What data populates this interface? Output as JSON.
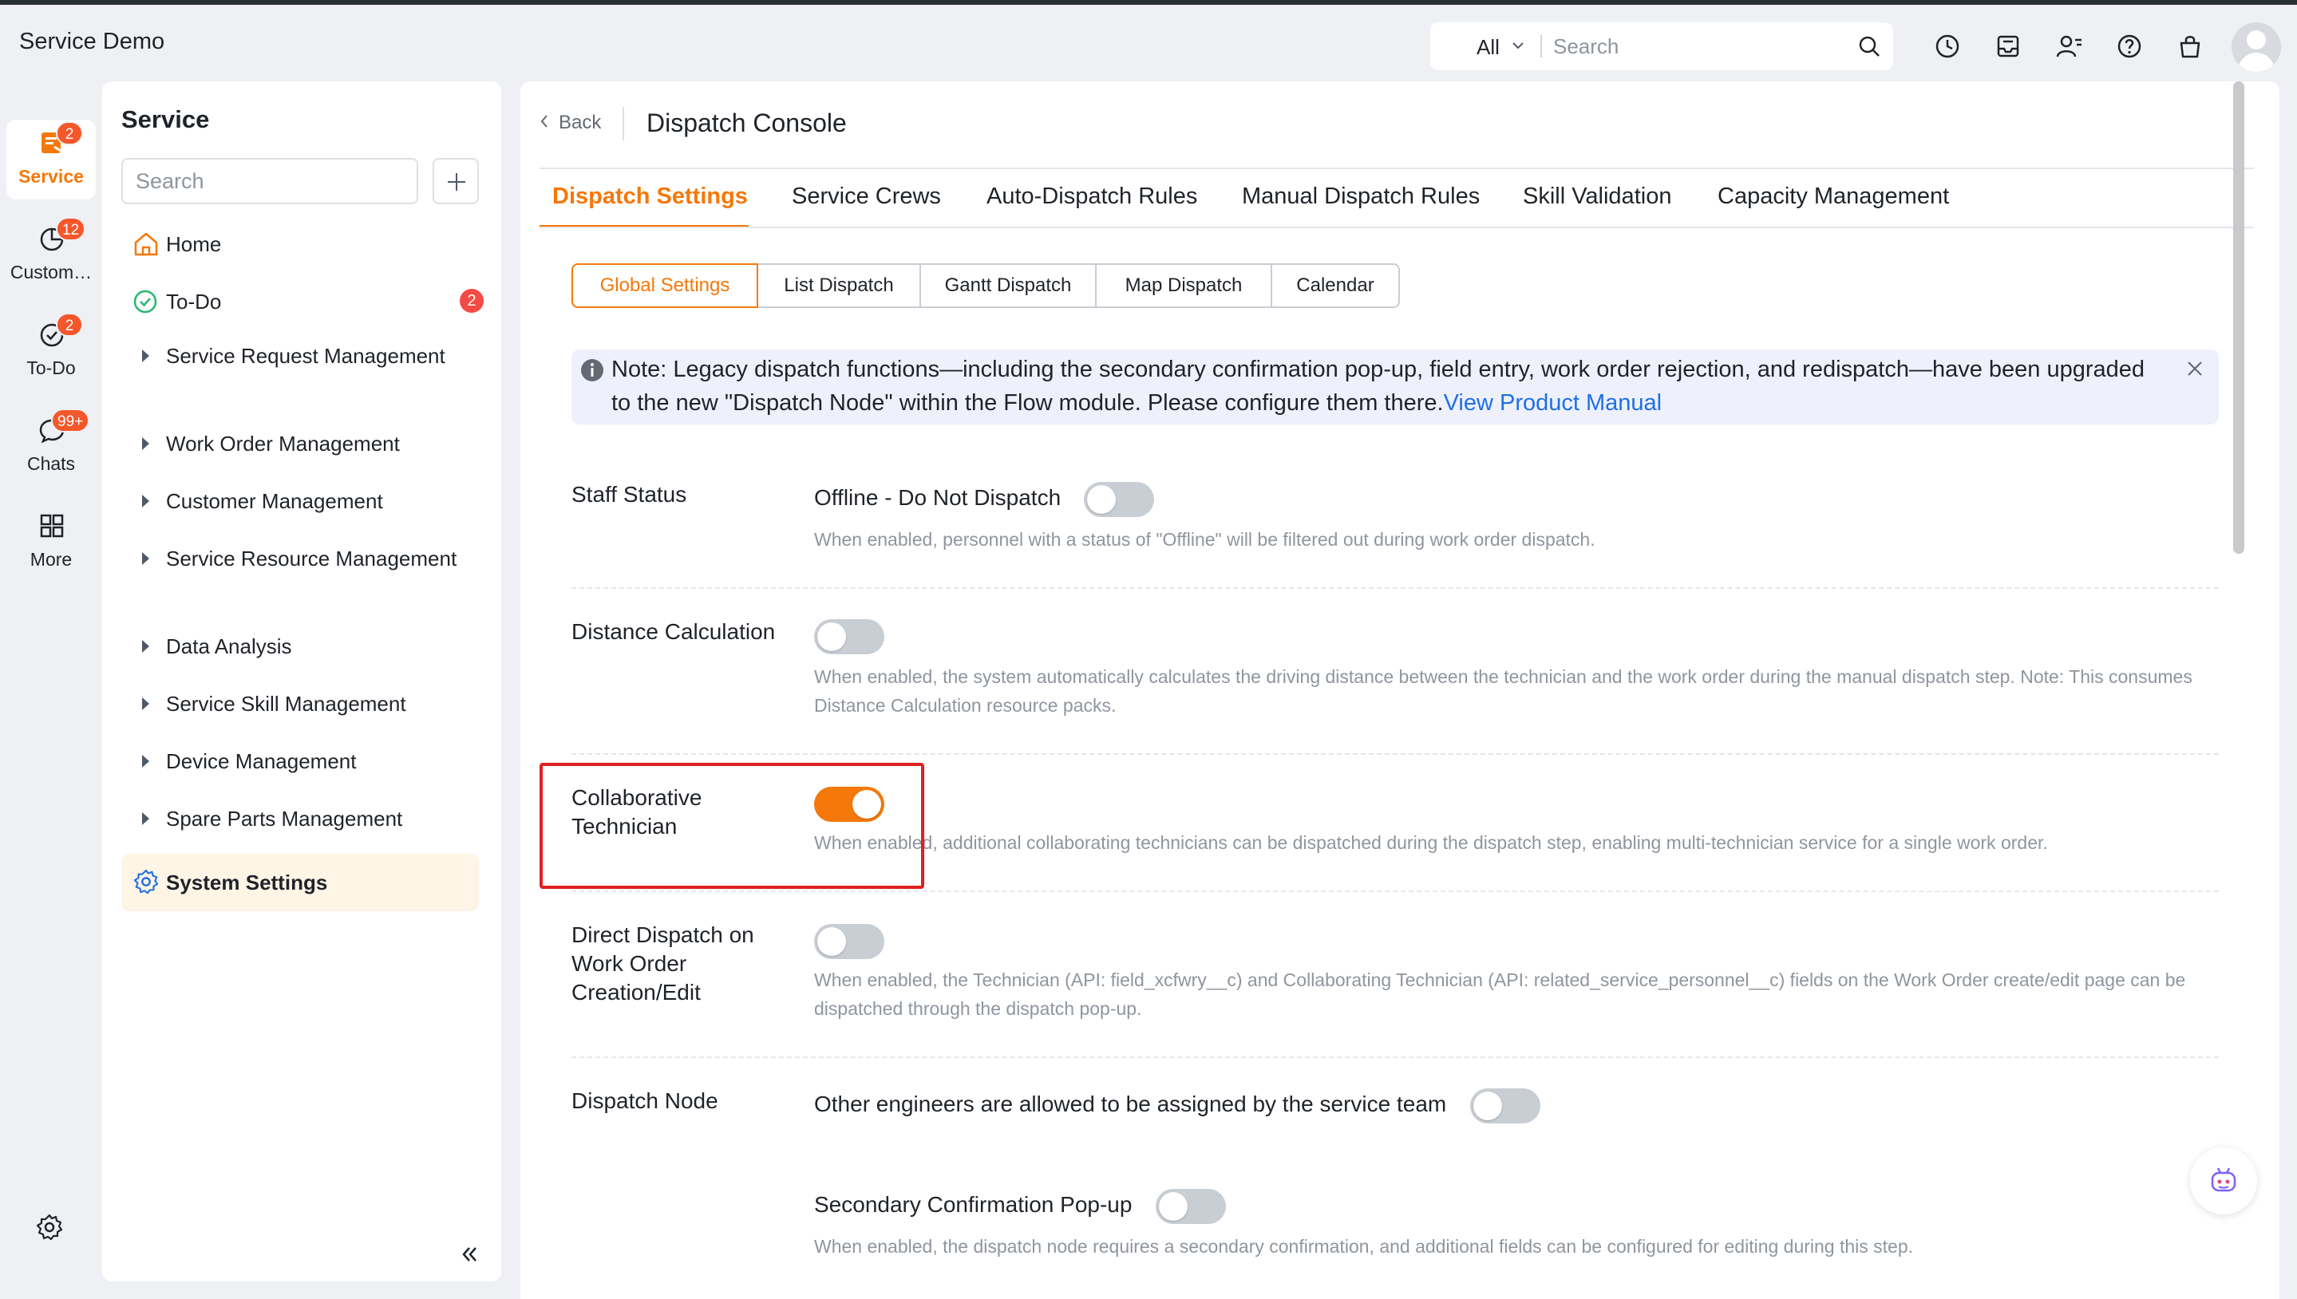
{
  "app": {
    "title": "Service Demo"
  },
  "header": {
    "search_scope": "All",
    "search_placeholder": "Search",
    "icons": [
      "clock-icon",
      "inbox-icon",
      "contacts-icon",
      "help-icon",
      "bag-icon",
      "avatar"
    ]
  },
  "rail": {
    "items": [
      {
        "label": "Service",
        "badge": "2",
        "icon": "service-icon",
        "active": true
      },
      {
        "label": "Custom…",
        "badge": "12",
        "icon": "pie-chart-icon"
      },
      {
        "label": "To-Do",
        "badge": "2",
        "icon": "check-circle-icon"
      },
      {
        "label": "Chats",
        "badge": "99+",
        "icon": "chat-bubble-icon"
      },
      {
        "label": "More",
        "icon": "grid-icon"
      }
    ]
  },
  "sidenav": {
    "title": "Service",
    "search_placeholder": "Search",
    "items": [
      {
        "label": "Home",
        "icon": "home-icon"
      },
      {
        "label": "To-Do",
        "icon": "todo-check-icon",
        "badge": "2"
      },
      {
        "label": "Service Request Management"
      },
      {
        "label": "Work Order Management"
      },
      {
        "label": "Customer Management"
      },
      {
        "label": "Service Resource Management"
      },
      {
        "label": "Data Analysis"
      },
      {
        "label": "Service Skill Management"
      },
      {
        "label": "Device Management"
      },
      {
        "label": "Spare Parts Management"
      },
      {
        "label": "System Settings",
        "icon": "settings-icon",
        "active": true
      }
    ]
  },
  "page": {
    "back": "Back",
    "title": "Dispatch Console",
    "tabs": [
      "Dispatch Settings",
      "Service Crews",
      "Auto-Dispatch Rules",
      "Manual Dispatch Rules",
      "Skill Validation",
      "Capacity Management"
    ],
    "active_tab": "Dispatch Settings",
    "segments": [
      "Global Settings",
      "List Dispatch",
      "Gantt Dispatch",
      "Map Dispatch",
      "Calendar"
    ],
    "active_segment": "Global Settings",
    "notice": {
      "text": "Note: Legacy dispatch functions—including the secondary confirmation pop-up, field entry, work order rejection, and redispatch—have been upgraded to the new \"Dispatch Node\" within the Flow module. Please configure them there.",
      "link": "View Product Manual"
    },
    "settings": [
      {
        "label": "Staff Status",
        "title": "Offline - Do Not Dispatch",
        "enabled": false,
        "desc": "When enabled, personnel with a status of \"Offline\" will be filtered out during work order dispatch."
      },
      {
        "label": "Distance Calculation",
        "enabled": false,
        "desc": "When enabled, the system automatically calculates the driving distance between the technician and the work order during the manual dispatch step. Note: This consumes Distance Calculation resource packs."
      },
      {
        "label": "Collaborative Technician",
        "enabled": true,
        "desc": "When enabled, additional collaborating technicians can be dispatched during the dispatch step, enabling multi-technician service for a single work order."
      },
      {
        "label": "Direct Dispatch on Work Order Creation/Edit",
        "enabled": false,
        "desc": "When enabled, the Technician (API: field_xcfwry__c) and Collaborating Technician (API: related_service_personnel__c) fields on the Work Order create/edit page can be dispatched through the dispatch pop-up."
      },
      {
        "label": "Dispatch Node",
        "title": "Other engineers are allowed to be assigned by the service team",
        "enabled": false
      },
      {
        "title": "Secondary Confirmation Pop-up",
        "enabled": false,
        "desc": "When enabled, the dispatch node requires a secondary confirmation, and additional fields can be configured for editing during this step."
      }
    ]
  },
  "colors": {
    "accent": "#f5780a",
    "link": "#1f6fe5",
    "badge": "#f54a45",
    "highlight": "#e02020"
  }
}
